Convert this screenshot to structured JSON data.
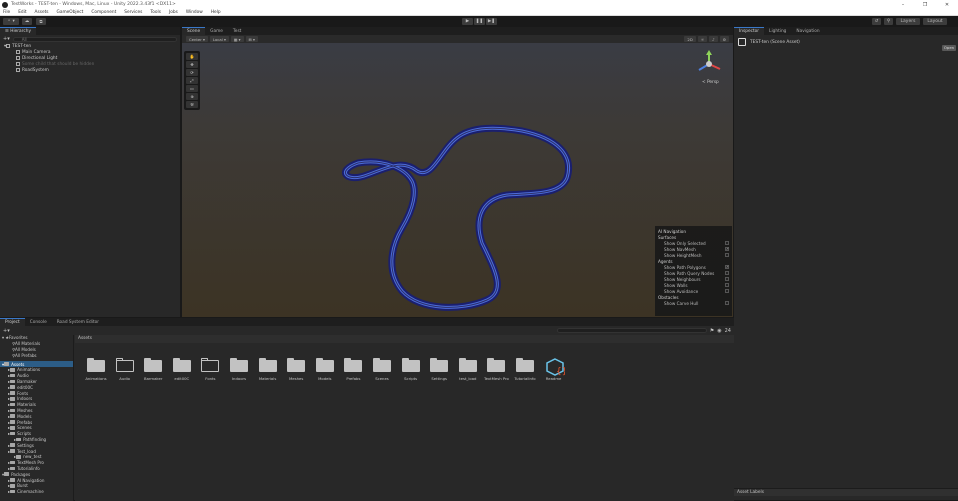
{
  "window": {
    "title": "TestWorks - TEST-ten - Windows, Mac, Linux - Unity 2022.3.43f1 <DX11>",
    "controls": [
      "–",
      "❐",
      "✕"
    ]
  },
  "menu": [
    "File",
    "Edit",
    "Assets",
    "GameObject",
    "Component",
    "Services",
    "Tools",
    "Jobs",
    "Window",
    "Help"
  ],
  "toolbar": {
    "account": "⚬ ▾",
    "cloud": "☁",
    "play": "▶",
    "pause": "❚❚",
    "step": "▶❚",
    "search": "⚲",
    "layers": "Layers",
    "layout": "Layout"
  },
  "hierarchy": {
    "tab": "Hierarchy",
    "search_placeholder": "All",
    "items": [
      {
        "label": "TEST-ten",
        "depth": 0,
        "type": "scene"
      },
      {
        "label": "Main Camera",
        "depth": 1,
        "type": "obj"
      },
      {
        "label": "Directional Light",
        "depth": 1,
        "type": "obj"
      },
      {
        "label": "Some child that should be hidden",
        "depth": 1,
        "type": "dim"
      },
      {
        "label": "RoadSystem",
        "depth": 1,
        "type": "obj"
      }
    ]
  },
  "scene": {
    "tabs": [
      "Scene",
      "Game",
      "Test"
    ],
    "toolbar": [
      "Center ▾",
      "Local ▾",
      "▦ ▾",
      "⊞ ▾"
    ],
    "toolbar_right": [
      "2D",
      "☼",
      "♪",
      "⚙"
    ],
    "persp_label": "< Persp",
    "tools": [
      "✋",
      "✥",
      "⟳",
      "⤢",
      "▭",
      "⊕",
      "⚒"
    ]
  },
  "nav_panel": {
    "title": "AI Navigation",
    "sections": [
      {
        "name": "Surfaces",
        "rows": [
          {
            "label": "Show Only Selected",
            "checked": false
          },
          {
            "label": "Show NavMesh",
            "checked": true
          },
          {
            "label": "Show HeightMesh",
            "checked": false
          }
        ]
      },
      {
        "name": "Agents",
        "rows": [
          {
            "label": "Show Path Polygons",
            "checked": true
          },
          {
            "label": "Show Path Query Nodes",
            "checked": false
          },
          {
            "label": "Show Neighbours",
            "checked": false
          },
          {
            "label": "Show Walls",
            "checked": false
          },
          {
            "label": "Show Avoidance",
            "checked": false
          }
        ]
      },
      {
        "name": "Obstacles",
        "rows": [
          {
            "label": "Show Carve Hull",
            "checked": false
          }
        ]
      }
    ]
  },
  "inspector": {
    "tabs": [
      "Inspector",
      "Lighting",
      "Navigation"
    ],
    "asset_name": "TEST-ten (Scene Asset)",
    "open_button": "Open",
    "footer": "Asset Labels"
  },
  "project": {
    "tabs": [
      "Project",
      "Console",
      "Road System Editor"
    ],
    "count": "24",
    "favorites": {
      "label": "Favorites",
      "items": [
        "All Materials",
        "All Models",
        "All Prefabs"
      ]
    },
    "tree": [
      {
        "label": "Assets",
        "depth": 0,
        "sel": true
      },
      {
        "label": "Animations",
        "depth": 1
      },
      {
        "label": "Audio",
        "depth": 1
      },
      {
        "label": "Barmaker",
        "depth": 1
      },
      {
        "label": "edit00C",
        "depth": 1
      },
      {
        "label": "Fonts",
        "depth": 1
      },
      {
        "label": "Indoors",
        "depth": 1
      },
      {
        "label": "Materials",
        "depth": 1
      },
      {
        "label": "Meshes",
        "depth": 1
      },
      {
        "label": "Models",
        "depth": 1
      },
      {
        "label": "Prefabs",
        "depth": 1
      },
      {
        "label": "Scenes",
        "depth": 1
      },
      {
        "label": "Scripts",
        "depth": 1
      },
      {
        "label": "Pathfinding",
        "depth": 2
      },
      {
        "label": "Settings",
        "depth": 1
      },
      {
        "label": "Test_load",
        "depth": 1
      },
      {
        "label": "new_test",
        "depth": 2
      },
      {
        "label": "TextMesh Pro",
        "depth": 1
      },
      {
        "label": "Tutorialinfo",
        "depth": 1
      },
      {
        "label": "Packages",
        "depth": 0
      },
      {
        "label": "AI Navigation",
        "depth": 1
      },
      {
        "label": "Burst",
        "depth": 1
      },
      {
        "label": "Cinemachine",
        "depth": 1
      }
    ],
    "breadcrumb": "Assets",
    "assets": [
      {
        "label": "Animations",
        "type": "folder"
      },
      {
        "label": "Audio",
        "type": "empty"
      },
      {
        "label": "Barmaker",
        "type": "folder"
      },
      {
        "label": "edit00C",
        "type": "folder"
      },
      {
        "label": "Fonts",
        "type": "empty"
      },
      {
        "label": "Indoors",
        "type": "folder"
      },
      {
        "label": "Materials",
        "type": "folder"
      },
      {
        "label": "Meshes",
        "type": "folder"
      },
      {
        "label": "Models",
        "type": "folder"
      },
      {
        "label": "Prefabs",
        "type": "folder"
      },
      {
        "label": "Scenes",
        "type": "folder"
      },
      {
        "label": "Scripts",
        "type": "folder"
      },
      {
        "label": "Settings",
        "type": "folder"
      },
      {
        "label": "test_load",
        "type": "folder"
      },
      {
        "label": "TextMesh Pro",
        "type": "folder"
      },
      {
        "label": "TutorialInfo",
        "type": "folder"
      },
      {
        "label": "Readme",
        "type": "readme"
      }
    ]
  }
}
